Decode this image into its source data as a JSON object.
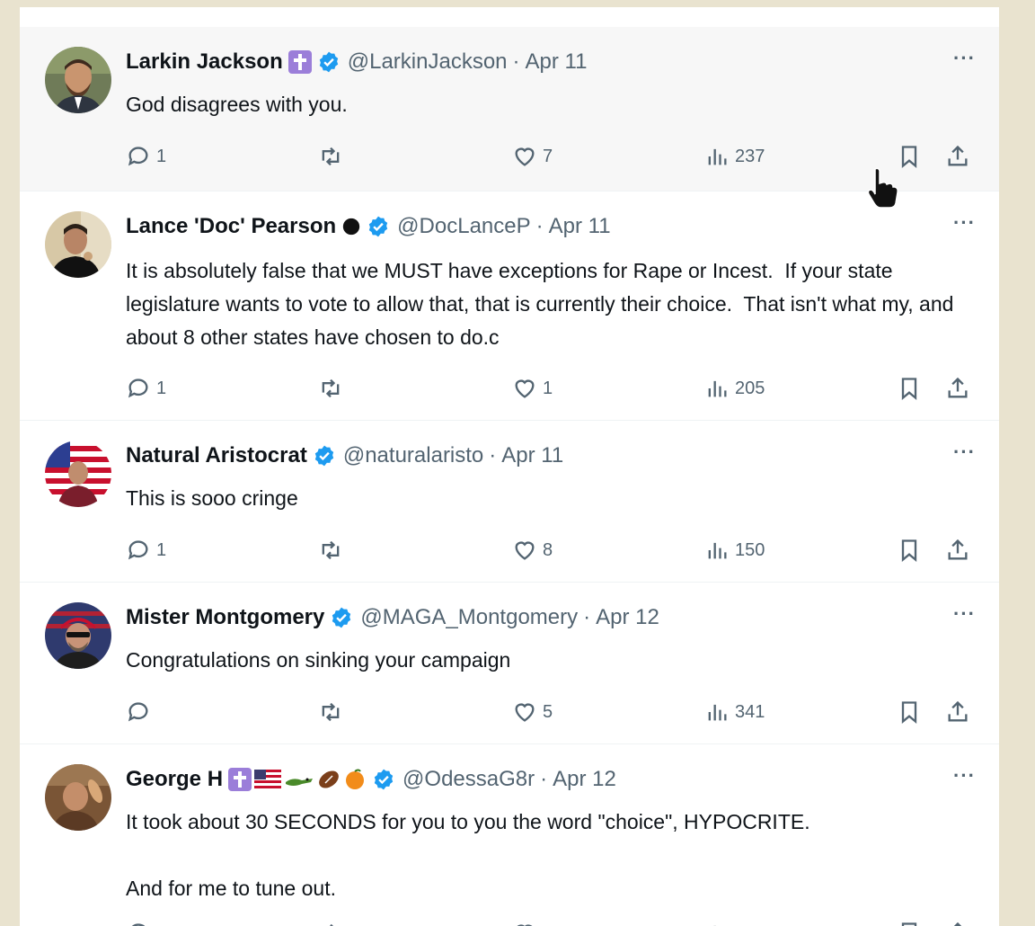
{
  "colors": {
    "verified": "#1d9bf0",
    "text_primary": "#0f1419",
    "text_secondary": "#536471",
    "page_background": "#e9e3cf",
    "hover_row": "#f7f7f7"
  },
  "icons": {
    "reply": "reply-icon",
    "retweet": "retweet-icon",
    "like": "heart-icon",
    "views": "views-chart-icon",
    "bookmark": "bookmark-icon",
    "share": "share-icon",
    "more": "more-dots-icon"
  },
  "more_label": "···",
  "date_separator": "·",
  "tweets": [
    {
      "name": "Larkin Jackson",
      "badges": [
        "cross-badge"
      ],
      "handle": "@LarkinJackson",
      "date": "Apr 11",
      "text": "God disagrees with you.",
      "replies": "1",
      "retweets": "",
      "likes": "7",
      "views": "237"
    },
    {
      "name": "Lance 'Doc' Pearson",
      "badges": [
        "black-circle"
      ],
      "handle": "@DocLanceP",
      "date": "Apr 11",
      "text": "It is absolutely false that we MUST have exceptions for Rape or Incest.  If your state legislature wants to vote to allow that, that is currently their choice.  That isn't what my, and about 8 other states have chosen to do.c",
      "replies": "1",
      "retweets": "",
      "likes": "1",
      "views": "205"
    },
    {
      "name": "Natural Aristocrat",
      "badges": [],
      "handle": "@naturalaristo",
      "date": "Apr 11",
      "text": "This is sooo cringe",
      "replies": "1",
      "retweets": "",
      "likes": "8",
      "views": "150"
    },
    {
      "name": "Mister Montgomery",
      "badges": [],
      "handle": "@MAGA_Montgomery",
      "date": "Apr 12",
      "text": "Congratulations on sinking your campaign",
      "replies": "",
      "retweets": "",
      "likes": "5",
      "views": "341"
    },
    {
      "name": "George H",
      "badges": [
        "cross-badge",
        "us-flag",
        "alligator",
        "football",
        "orange"
      ],
      "handle": "@OdessaG8r",
      "date": "Apr 12",
      "text": "It took about 30 SECONDS for you to you the word \"choice\", HYPOCRITE.\n\nAnd for me to tune out.",
      "replies": "",
      "retweets": "",
      "likes": "",
      "views": ""
    }
  ]
}
